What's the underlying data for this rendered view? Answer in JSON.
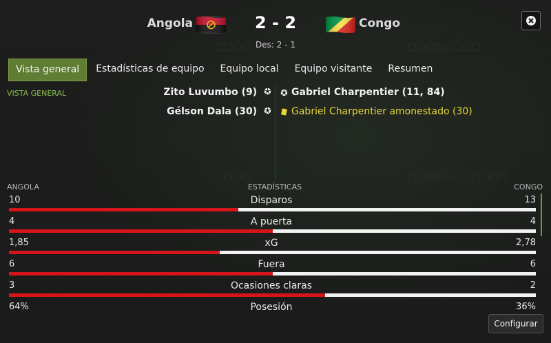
{
  "header": {
    "home_team": "Angola",
    "away_team": "Congo",
    "score": "2 - 2",
    "aggregate": "Des: 2 - 1"
  },
  "tabs": [
    {
      "label": "Vista general"
    },
    {
      "label": "Estadísticas de equipo"
    },
    {
      "label": "Equipo local"
    },
    {
      "label": "Equipo visitante"
    },
    {
      "label": "Resumen"
    }
  ],
  "section_label": "VISTA GENERAL",
  "events": {
    "home": [
      {
        "text": "Zito Luvumbo (9)",
        "icon": "ball-icon"
      },
      {
        "text": "Gélson Dala (30)",
        "icon": "ball-icon"
      }
    ],
    "away": [
      {
        "text": "Gabriel Charpentier (11, 84)",
        "icon": "ball-icon"
      },
      {
        "text": "Gabriel Charpentier amonestado (30)",
        "icon": "yellow-card-icon"
      }
    ]
  },
  "stats": {
    "home_label": "ANGOLA",
    "title": "ESTADÍSTICAS",
    "away_label": "CONGO",
    "rows": [
      {
        "name": "Disparos",
        "home": "10",
        "away": "13",
        "home_share": 0.4348
      },
      {
        "name": "A puerta",
        "home": "4",
        "away": "4",
        "home_share": 0.5
      },
      {
        "name": "xG",
        "home": "1,85",
        "away": "2,78",
        "home_share": 0.3996
      },
      {
        "name": "Fuera",
        "home": "6",
        "away": "6",
        "home_share": 0.5
      },
      {
        "name": "Ocasiones claras",
        "home": "3",
        "away": "2",
        "home_share": 0.6
      },
      {
        "name": "Posesión",
        "home": "64%",
        "away": "36%",
        "home_share": 0.64
      }
    ]
  },
  "buttons": {
    "configure": "Configurar"
  },
  "colors": {
    "accent_green": "#5f7d33",
    "bar_home": "#d6151b",
    "bar_away": "#f2f2f2",
    "yellow_card": "#e7d53a"
  }
}
